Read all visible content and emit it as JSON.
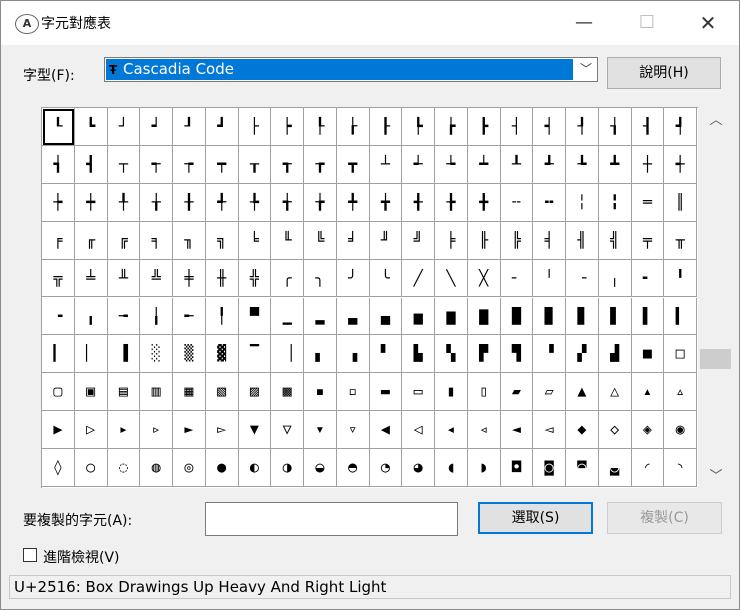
{
  "window": {
    "title": "字元對應表",
    "minimize": "—",
    "maximize": "☐",
    "close": "✕"
  },
  "font_label": "字型(F):",
  "font_select": {
    "value": "Cascadia Code",
    "icon": "Ŧ",
    "arrow": "﹀"
  },
  "help_button": "說明(H)",
  "grid": {
    "cols": 20,
    "selected_index": 0,
    "chars": [
      "┖",
      "┗",
      "┘",
      "┙",
      "┚",
      "┛",
      "├",
      "┝",
      "┞",
      "┟",
      "┠",
      "┡",
      "┢",
      "┣",
      "┤",
      "┥",
      "┦",
      "┧",
      "┨",
      "┩",
      "┪",
      "┫",
      "┬",
      "┭",
      "┮",
      "┯",
      "┰",
      "┱",
      "┲",
      "┳",
      "┴",
      "┵",
      "┶",
      "┷",
      "┸",
      "┹",
      "┺",
      "┻",
      "┼",
      "┽",
      "┾",
      "┿",
      "╀",
      "╁",
      "╂",
      "╃",
      "╄",
      "╅",
      "╆",
      "╇",
      "╈",
      "╉",
      "╊",
      "╋",
      "╌",
      "╍",
      "╎",
      "╏",
      "═",
      "║",
      "╒",
      "╓",
      "╔",
      "╕",
      "╖",
      "╗",
      "╘",
      "╙",
      "╚",
      "╛",
      "╜",
      "╝",
      "╞",
      "╟",
      "╠",
      "╡",
      "╢",
      "╣",
      "╤",
      "╥",
      "╦",
      "╧",
      "╨",
      "╩",
      "╪",
      "╫",
      "╬",
      "╭",
      "╮",
      "╯",
      "╰",
      "╱",
      "╲",
      "╳",
      "╴",
      "╵",
      "╶",
      "╷",
      "╸",
      "╹",
      "╺",
      "╻",
      "╼",
      "╽",
      "╾",
      "╿",
      "▀",
      "▁",
      "▂",
      "▃",
      "▄",
      "▅",
      "▆",
      "▇",
      "█",
      "▉",
      "▊",
      "▋",
      "▌",
      "▍",
      "▎",
      "▏",
      "▐",
      "░",
      "▒",
      "▓",
      "▔",
      "▕",
      "▖",
      "▗",
      "▘",
      "▙",
      "▚",
      "▛",
      "▜",
      "▝",
      "▞",
      "▟",
      "■",
      "□",
      "▢",
      "▣",
      "▤",
      "▥",
      "▦",
      "▧",
      "▨",
      "▩",
      "▪",
      "▫",
      "▬",
      "▭",
      "▮",
      "▯",
      "▰",
      "▱",
      "▲",
      "△",
      "▴",
      "▵",
      "▶",
      "▷",
      "▸",
      "▹",
      "►",
      "▻",
      "▼",
      "▽",
      "▾",
      "▿",
      "◀",
      "◁",
      "◂",
      "◃",
      "◄",
      "◅",
      "◆",
      "◇",
      "◈",
      "◉",
      "◊",
      "○",
      "◌",
      "◍",
      "◎",
      "●",
      "◐",
      "◑",
      "◒",
      "◓",
      "◔",
      "◕",
      "◖",
      "◗",
      "◘",
      "◙",
      "◚",
      "◛",
      "◜",
      "◝"
    ]
  },
  "scrollbar": {
    "up": "︿",
    "down": "﹀"
  },
  "copy_label": "要複製的字元(A):",
  "copy_input_value": "",
  "select_button": "選取(S)",
  "copy_button": "複製(C)",
  "advanced_view": {
    "label": "進階檢視(V)",
    "checked": false
  },
  "status": "U+2516: Box Drawings Up Heavy And Right Light"
}
